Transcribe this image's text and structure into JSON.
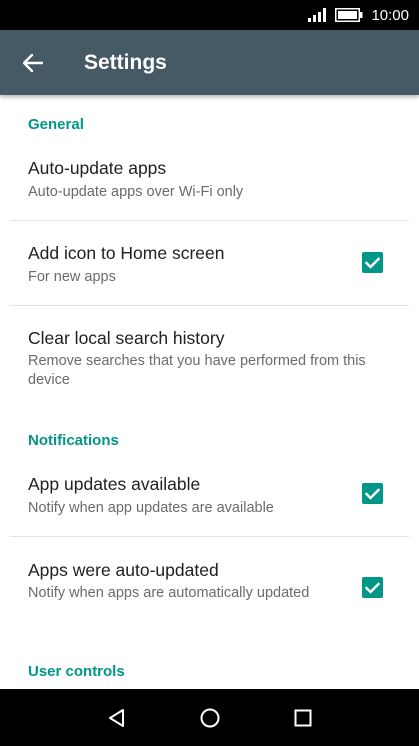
{
  "status_bar": {
    "time": "10:00"
  },
  "app_bar": {
    "title": "Settings"
  },
  "sections": {
    "general": "General",
    "notifications": "Notifications",
    "user_controls": "User controls"
  },
  "items": {
    "auto_update": {
      "title": "Auto-update apps",
      "subtitle": "Auto-update apps over Wi-Fi only"
    },
    "add_icon": {
      "title": "Add icon to Home screen",
      "subtitle": "For new apps",
      "checked": true
    },
    "clear_history": {
      "title": "Clear local search history",
      "subtitle": "Remove searches that you have performed from this device"
    },
    "app_updates": {
      "title": "App updates available",
      "subtitle": "Notify when app updates are available",
      "checked": true
    },
    "auto_updated": {
      "title": "Apps were auto-updated",
      "subtitle": "Notify when apps are automatically updated",
      "checked": true
    }
  },
  "colors": {
    "accent": "#009688",
    "app_bar": "#455a64"
  }
}
